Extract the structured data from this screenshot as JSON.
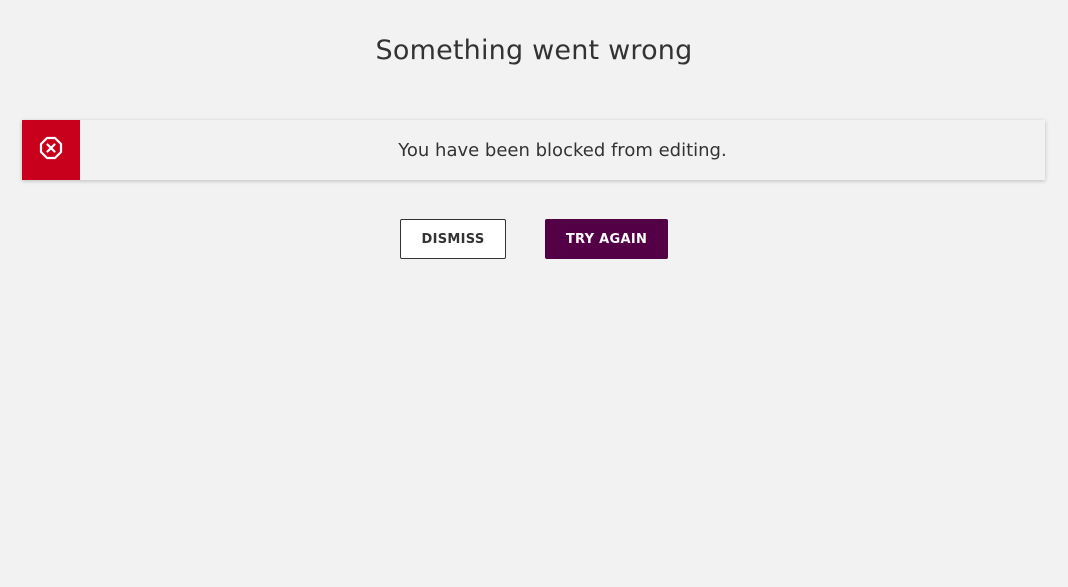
{
  "colors": {
    "background": "#f2f2f2",
    "error_red": "#c9001b",
    "primary_purple": "#540046",
    "text": "#333333"
  },
  "dialog": {
    "title": "Something went wrong"
  },
  "alert": {
    "icon": "error-x-octagon-icon",
    "message": "You have been blocked from editing."
  },
  "actions": {
    "dismiss_label": "DISMISS",
    "retry_label": "TRY AGAIN"
  }
}
